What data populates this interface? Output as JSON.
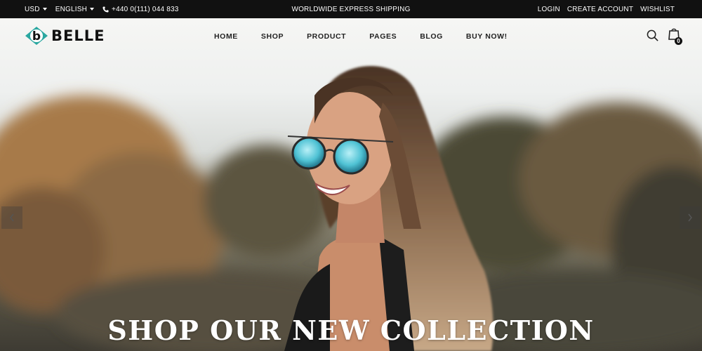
{
  "topbar": {
    "currency": "USD",
    "language": "ENGLISH",
    "phone": "+440 0(111) 044 833",
    "promo": "WORLDWIDE EXPRESS SHIPPING",
    "login": "LOGIN",
    "create_account": "CREATE ACCOUNT",
    "wishlist": "WISHLIST"
  },
  "header": {
    "logo_letter": "b",
    "logo_text": "BELLE",
    "nav": [
      "HOME",
      "SHOP",
      "PRODUCT",
      "PAGES",
      "BLOG",
      "BUY NOW!"
    ],
    "cart_count": "0"
  },
  "hero": {
    "headline": "SHOP OUR NEW COLLECTION"
  },
  "colors": {
    "topbar_bg": "#111111",
    "logo_accent": "#2aa7a0",
    "text_dark": "#222222"
  },
  "icons": {
    "search": "search-icon",
    "cart": "shopping-bag-icon",
    "phone": "phone-icon",
    "prev": "chevron-left-icon",
    "next": "chevron-right-icon"
  }
}
